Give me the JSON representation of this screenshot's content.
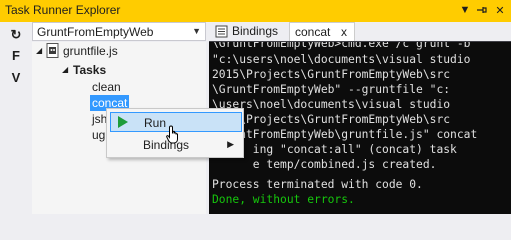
{
  "window": {
    "title": "Task Runner Explorer"
  },
  "title_buttons": {
    "dropdown": "▼",
    "pin": "⊣",
    "close": "✕"
  },
  "toolbar": {
    "refresh": "↻",
    "f_label": "F",
    "v_label": "V"
  },
  "project_combo": {
    "value": "GruntFromEmptyWeb",
    "arrow": "▼"
  },
  "tree": {
    "file": "gruntfile.js",
    "tasks_label": "Tasks",
    "items": [
      "clean",
      "concat",
      "jshint",
      "uglify"
    ],
    "items_visible": [
      "clean",
      "concat",
      "jsh",
      "ug"
    ]
  },
  "tabs": [
    {
      "label": "Bindings"
    },
    {
      "label": "concat",
      "close": "x"
    }
  ],
  "console": {
    "lines": [
      "\\GruntFromEmptyWeb>cmd.exe /c grunt -b",
      "\"c:\\users\\noel\\documents\\visual studio",
      "2015\\Projects\\GruntFromEmptyWeb\\src",
      "\\GruntFromEmptyWeb\" --gruntfile \"c:",
      "\\users\\noel\\documents\\visual studio",
      "2015\\Projects\\GruntFromEmptyWeb\\src",
      "\\GruntFromEmptyWeb\\gruntfile.js\" concat",
      "      ing \"concat:all\" (concat) task",
      "      e temp/combined.js created.",
      "",
      "Process terminated with code 0."
    ],
    "success": "Done, without errors."
  },
  "context_menu": {
    "items": [
      {
        "label": "Run"
      },
      {
        "label": "Bindings",
        "submenu": "▶"
      }
    ]
  },
  "colors": {
    "accent": "#ffcc00",
    "selection": "#3399ff",
    "console_bg": "#0c0c0c",
    "success": "#16c60c",
    "run_icon": "#1e9c3a"
  }
}
